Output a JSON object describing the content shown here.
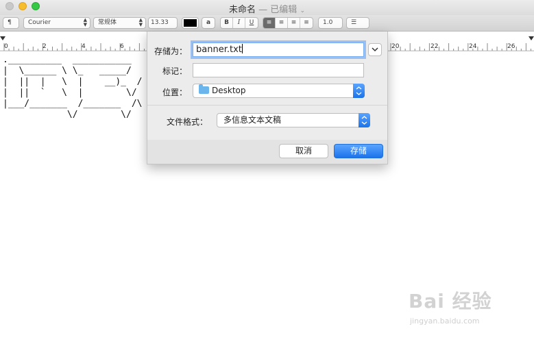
{
  "window": {
    "title": "未命名",
    "edited": "— 已编辑",
    "title_chevron": "⌄"
  },
  "toolbar": {
    "paragraph_style": "¶",
    "font_family": "Courier",
    "font_style": "常规体",
    "font_size": "13.33",
    "text_color": "#000000",
    "highlight_label": "a",
    "bold": "B",
    "italic": "I",
    "underline": "U",
    "line_spacing": "1.0",
    "list_bullet": "☰"
  },
  "ruler": {
    "ticks": [
      "0",
      "2",
      "4",
      "6",
      "20",
      "22",
      "24",
      "26"
    ]
  },
  "document": {
    "ascii_art": ".__________  ___________\n|  \\______ \\ \\_   _____/\n|  ||  |   \\  |    __)_  /\n|  ||  `   \\  |        \\/\n|___/_______  /_______  /\\\n            \\/        \\/"
  },
  "save_dialog": {
    "save_as_label": "存储为：",
    "save_as_value": "banner.txt",
    "tags_label": "标记：",
    "tags_value": "",
    "location_label": "位置：",
    "location_value": "Desktop",
    "format_label": "文件格式：",
    "format_value": "多信息文本文稿",
    "cancel_label": "取消",
    "save_label": "存储",
    "accent_color": "#1b73ea"
  },
  "watermark": {
    "logo": "Bai 经验",
    "url": "jingyan.baidu.com"
  }
}
